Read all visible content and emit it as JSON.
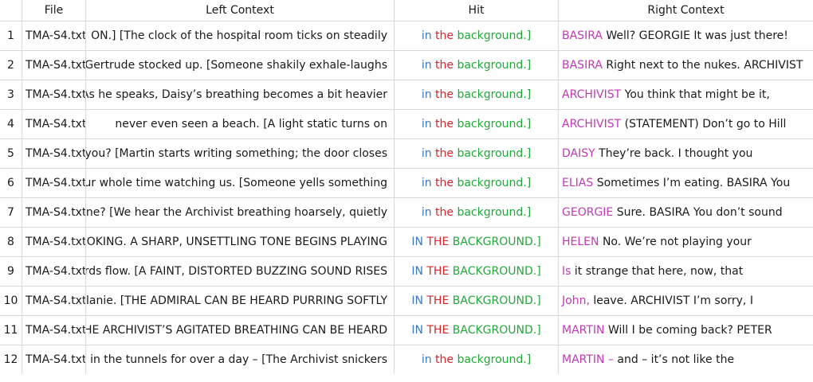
{
  "colors": {
    "blue": "#3b78c5",
    "red": "#d8262b",
    "green": "#22a83a",
    "magenta": "#c03ab6",
    "text": "#1a1a1a",
    "grid": "#d9d9d9"
  },
  "headers": {
    "file": "File",
    "left": "Left Context",
    "hit": "Hit",
    "right": "Right Context"
  },
  "rows": [
    {
      "index": "1",
      "file": "TMA-S4.txt",
      "left": "ON.] [The clock of the hospital room ticks on steadily",
      "hit": [
        {
          "t": "in",
          "c": "blue"
        },
        {
          "t": " ",
          "c": "text"
        },
        {
          "t": "the",
          "c": "red"
        },
        {
          "t": " ",
          "c": "text"
        },
        {
          "t": "background.]",
          "c": "green"
        }
      ],
      "right": [
        {
          "t": "BASIRA",
          "c": "magenta"
        },
        {
          "t": " Well? GEORGIE It was just there!",
          "c": "text"
        }
      ]
    },
    {
      "index": "2",
      "file": "TMA-S4.txt",
      "left": "one Gertrude stocked up. [Someone shakily exhale-laughs",
      "hit": [
        {
          "t": "in",
          "c": "blue"
        },
        {
          "t": " ",
          "c": "text"
        },
        {
          "t": "the",
          "c": "red"
        },
        {
          "t": " ",
          "c": "text"
        },
        {
          "t": "background.]",
          "c": "green"
        }
      ],
      "right": [
        {
          "t": "BASIRA",
          "c": "magenta"
        },
        {
          "t": " Right next to the nukes. ARCHIVIST",
          "c": "text"
        }
      ]
    },
    {
      "index": "3",
      "file": "TMA-S4.txt",
      "left": "As he speaks, Daisy’s breathing becomes a bit heavier",
      "hit": [
        {
          "t": "in",
          "c": "blue"
        },
        {
          "t": " ",
          "c": "text"
        },
        {
          "t": "the",
          "c": "red"
        },
        {
          "t": " ",
          "c": "text"
        },
        {
          "t": "background.]",
          "c": "green"
        }
      ],
      "right": [
        {
          "t": "ARCHIVIST",
          "c": "magenta"
        },
        {
          "t": " You think that might be it,",
          "c": "text"
        }
      ]
    },
    {
      "index": "4",
      "file": "TMA-S4.txt",
      "left": "never even seen a beach. [A light static turns on",
      "hit": [
        {
          "t": "in",
          "c": "blue"
        },
        {
          "t": " ",
          "c": "text"
        },
        {
          "t": "the",
          "c": "red"
        },
        {
          "t": " ",
          "c": "text"
        },
        {
          "t": "background.]",
          "c": "green"
        }
      ],
      "right": [
        {
          "t": "ARCHIVIST",
          "c": "magenta"
        },
        {
          "t": " (",
          "c": "text"
        },
        {
          "t": "STATEMENT) Don’t go to Hill",
          "c": "text"
        }
      ]
    },
    {
      "index": "5",
      "file": "TMA-S4.txt",
      "left": "oin you? [Martin starts writing something; the door closes",
      "hit": [
        {
          "t": "in",
          "c": "blue"
        },
        {
          "t": " ",
          "c": "text"
        },
        {
          "t": "the",
          "c": "red"
        },
        {
          "t": " ",
          "c": "text"
        },
        {
          "t": "background.]",
          "c": "green"
        }
      ],
      "right": [
        {
          "t": "DAISY",
          "c": "magenta"
        },
        {
          "t": " They’re back. I thought you",
          "c": "text"
        }
      ]
    },
    {
      "index": "6",
      "file": "TMA-S4.txt",
      "left": "l your whole time watching us. [Someone yells something",
      "hit": [
        {
          "t": "in",
          "c": "blue"
        },
        {
          "t": " ",
          "c": "text"
        },
        {
          "t": "the",
          "c": "red"
        },
        {
          "t": " ",
          "c": "text"
        },
        {
          "t": "background.]",
          "c": "green"
        }
      ],
      "right": [
        {
          "t": "ELIAS",
          "c": "magenta"
        },
        {
          "t": " Sometimes I’m eating. BASIRA You",
          "c": "text"
        }
      ]
    },
    {
      "index": "7",
      "file": "TMA-S4.txt",
      "left": "he one? [We hear the Archivist breathing hoarsely, quietly",
      "hit": [
        {
          "t": "in",
          "c": "blue"
        },
        {
          "t": " ",
          "c": "text"
        },
        {
          "t": "the",
          "c": "red"
        },
        {
          "t": " ",
          "c": "text"
        },
        {
          "t": "background.]",
          "c": "green"
        }
      ],
      "right": [
        {
          "t": "GEORGIE",
          "c": "magenta"
        },
        {
          "t": " Sure. BASIRA You don’t sound",
          "c": "text"
        }
      ]
    },
    {
      "index": "8",
      "file": "TMA-S4.txt",
      "left": "CHOKING. A SHARP, UNSETTLING TONE BEGINS PLAYING",
      "hit": [
        {
          "t": "IN",
          "c": "blue"
        },
        {
          "t": " ",
          "c": "text"
        },
        {
          "t": "THE",
          "c": "red"
        },
        {
          "t": " ",
          "c": "text"
        },
        {
          "t": "BACKGROUND.]",
          "c": "green"
        }
      ],
      "right": [
        {
          "t": "HELEN",
          "c": "magenta"
        },
        {
          "t": " No. We’re not playing your",
          "c": "text"
        }
      ]
    },
    {
      "index": "9",
      "file": "TMA-S4.txt",
      "left": "vords flow. [A FAINT, DISTORTED BUZZING SOUND RISES",
      "hit": [
        {
          "t": "IN",
          "c": "blue"
        },
        {
          "t": " ",
          "c": "text"
        },
        {
          "t": "THE",
          "c": "red"
        },
        {
          "t": " ",
          "c": "text"
        },
        {
          "t": "BACKGROUND.]",
          "c": "green"
        }
      ],
      "right": [
        {
          "t": "Is",
          "c": "magenta"
        },
        {
          "t": " it strange that here, now, that",
          "c": "text"
        }
      ]
    },
    {
      "index": "10",
      "file": "TMA-S4.txt",
      "left": "Melanie. [THE ADMIRAL CAN BE HEARD PURRING SOFTLY",
      "hit": [
        {
          "t": "IN",
          "c": "blue"
        },
        {
          "t": " ",
          "c": "text"
        },
        {
          "t": "THE",
          "c": "red"
        },
        {
          "t": " ",
          "c": "text"
        },
        {
          "t": "BACKGROUND.]",
          "c": "green"
        }
      ],
      "right": [
        {
          "t": "John,",
          "c": "magenta"
        },
        {
          "t": " leave. ARCHIVIST I’m sorry, I",
          "c": "text"
        }
      ]
    },
    {
      "index": "11",
      "file": "TMA-S4.txt",
      "left": "THE ARCHIVIST’S AGITATED BREATHING CAN BE HEARD",
      "hit": [
        {
          "t": "IN",
          "c": "blue"
        },
        {
          "t": " ",
          "c": "text"
        },
        {
          "t": "THE",
          "c": "red"
        },
        {
          "t": " ",
          "c": "text"
        },
        {
          "t": "BACKGROUND.]",
          "c": "green"
        }
      ],
      "right": [
        {
          "t": "MARTIN",
          "c": "magenta"
        },
        {
          "t": " Will I be coming back? PETER",
          "c": "text"
        }
      ]
    },
    {
      "index": "12",
      "file": "TMA-S4.txt",
      "left": "in the tunnels for over a day – [The Archivist snickers",
      "hit": [
        {
          "t": "in",
          "c": "blue"
        },
        {
          "t": " ",
          "c": "text"
        },
        {
          "t": "the",
          "c": "red"
        },
        {
          "t": " ",
          "c": "text"
        },
        {
          "t": "background.]",
          "c": "green"
        }
      ],
      "right": [
        {
          "t": "MARTIN",
          "c": "magenta"
        },
        {
          "t": " –",
          "c": "magenta"
        },
        {
          "t": " and – it’s not like the",
          "c": "text"
        }
      ]
    }
  ]
}
